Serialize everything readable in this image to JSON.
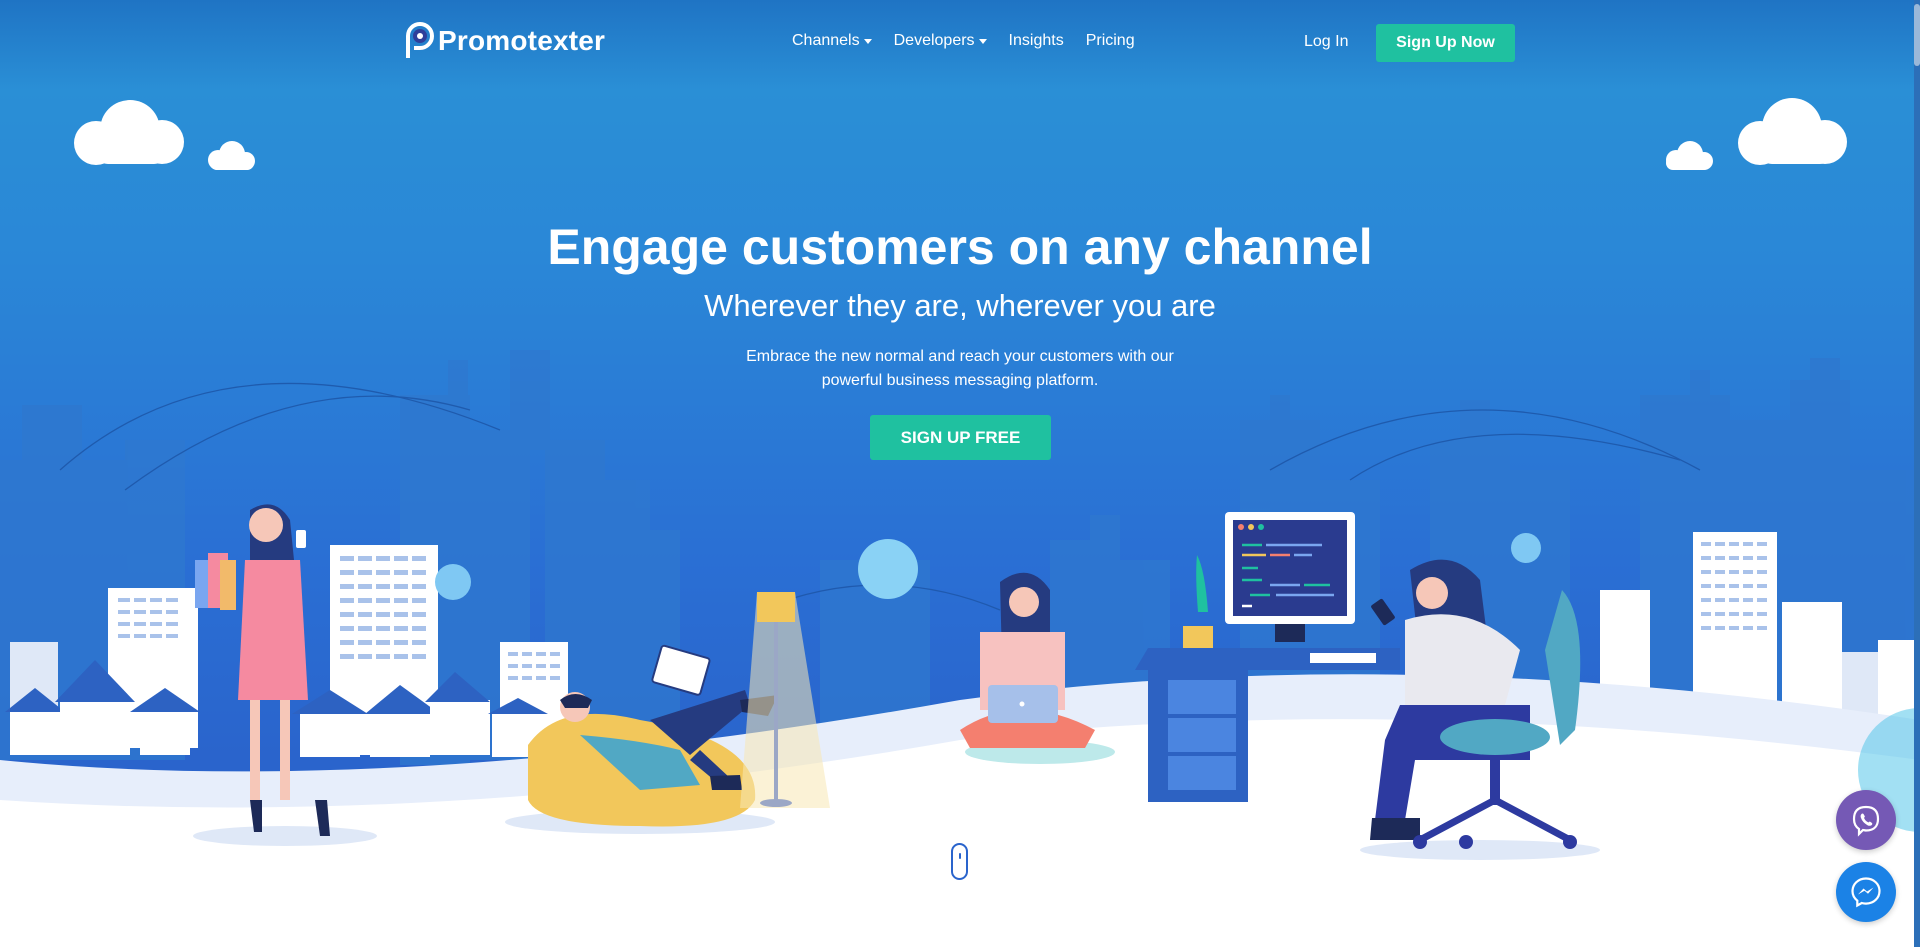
{
  "nav": {
    "brand": "Promotexter",
    "links": [
      {
        "label": "Channels",
        "dropdown": true
      },
      {
        "label": "Developers",
        "dropdown": true
      },
      {
        "label": "Insights",
        "dropdown": false
      },
      {
        "label": "Pricing",
        "dropdown": false
      }
    ],
    "login_label": "Log In",
    "signup_label": "Sign Up Now"
  },
  "hero": {
    "headline": "Engage customers on any channel",
    "subheadline": "Wherever they are, wherever you are",
    "description_line1": "Embrace the new normal and reach your customers with our",
    "description_line2": "powerful business messaging platform.",
    "cta_label": "SIGN UP FREE"
  },
  "floating_buttons": {
    "viber_icon": "viber-icon",
    "messenger_icon": "messenger-icon"
  },
  "colors": {
    "hero_blue": "#2a87d7",
    "accent_green": "#1fc1a0",
    "viber_purple": "#7559b5",
    "messenger_blue": "#1b82e6"
  }
}
